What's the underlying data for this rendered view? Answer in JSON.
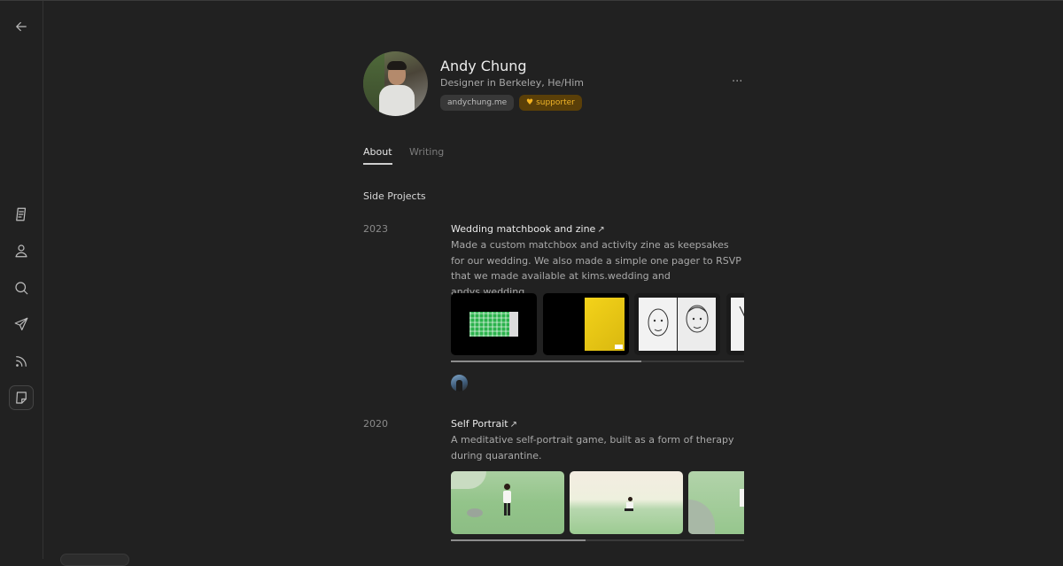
{
  "profile": {
    "name": "Andy Chung",
    "bio": "Designer in Berkeley, He/Him",
    "website": "andychung.me",
    "supporter_label": "supporter",
    "more_label": "···"
  },
  "tabs": [
    {
      "label": "About",
      "active": true
    },
    {
      "label": "Writing",
      "active": false
    }
  ],
  "sections": {
    "side_projects_title": "Side Projects"
  },
  "projects": [
    {
      "year": "2023",
      "title": "Wedding matchbook and zine",
      "arrow": "↗",
      "description": "Made a custom matchbox and activity zine as keepsakes for our wedding. We also made a simple one pager to RSVP that we made available at kims.wedding and andys.wedding.",
      "gallery_scroll_progress": 0.65
    },
    {
      "year": "2020",
      "title": "Self Portrait",
      "arrow": "↗",
      "description": "A meditative self-portrait game, built as a form of therapy during quarantine.",
      "gallery_scroll_progress": 0.46
    }
  ],
  "sidebar": {
    "items": [
      {
        "icon": "back-arrow-icon"
      },
      {
        "icon": "notes-icon"
      },
      {
        "icon": "profile-icon"
      },
      {
        "icon": "search-icon"
      },
      {
        "icon": "send-icon"
      },
      {
        "icon": "rss-icon"
      },
      {
        "icon": "sticky-note-icon",
        "active": true
      }
    ]
  },
  "colors": {
    "background": "#212121",
    "supporter_bg": "#5a3f08",
    "supporter_text": "#f0b429",
    "text_primary": "#e6e6e6",
    "text_secondary": "#a9a9a9"
  }
}
